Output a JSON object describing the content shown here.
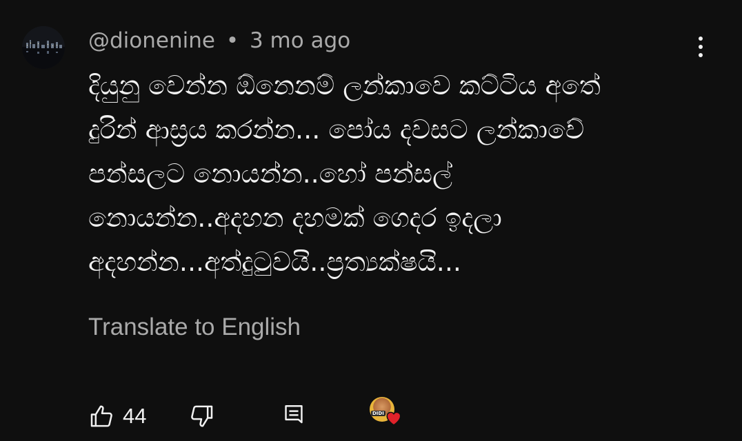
{
  "comment": {
    "author": "@dionenine",
    "separator": "•",
    "timestamp": "3 mo ago",
    "text_lines": [
      "දියුනු වෙන්න ඕනෙනම් ලන්කාවෙ කට්ටිය අතේ",
      "දුරින් ආස්‍රය කරන්න... පෝය දවසට ලන්කාවේ",
      "පන්සලට නොයන්න..හෝ පන්සල්",
      "නොයන්න..අදහන දහමක් ගෙදර ඉදලා",
      "අදහන්න...අත්දුටුවයි..ප්‍රත්‍යක්ෂයි..."
    ],
    "translate_label": "Translate to English"
  },
  "actions": {
    "like_count": "44",
    "like_icon": "thumb-up-icon",
    "dislike_icon": "thumb-down-icon",
    "reply_icon": "reply-icon",
    "creator_heart_icon": "creator-heart-icon",
    "creator_avatar_text": "DIDI"
  },
  "colors": {
    "background": "#0f0f0f",
    "text_primary": "#f1f1f1",
    "text_secondary": "#aaaaaa",
    "heart": "#e0222a"
  }
}
